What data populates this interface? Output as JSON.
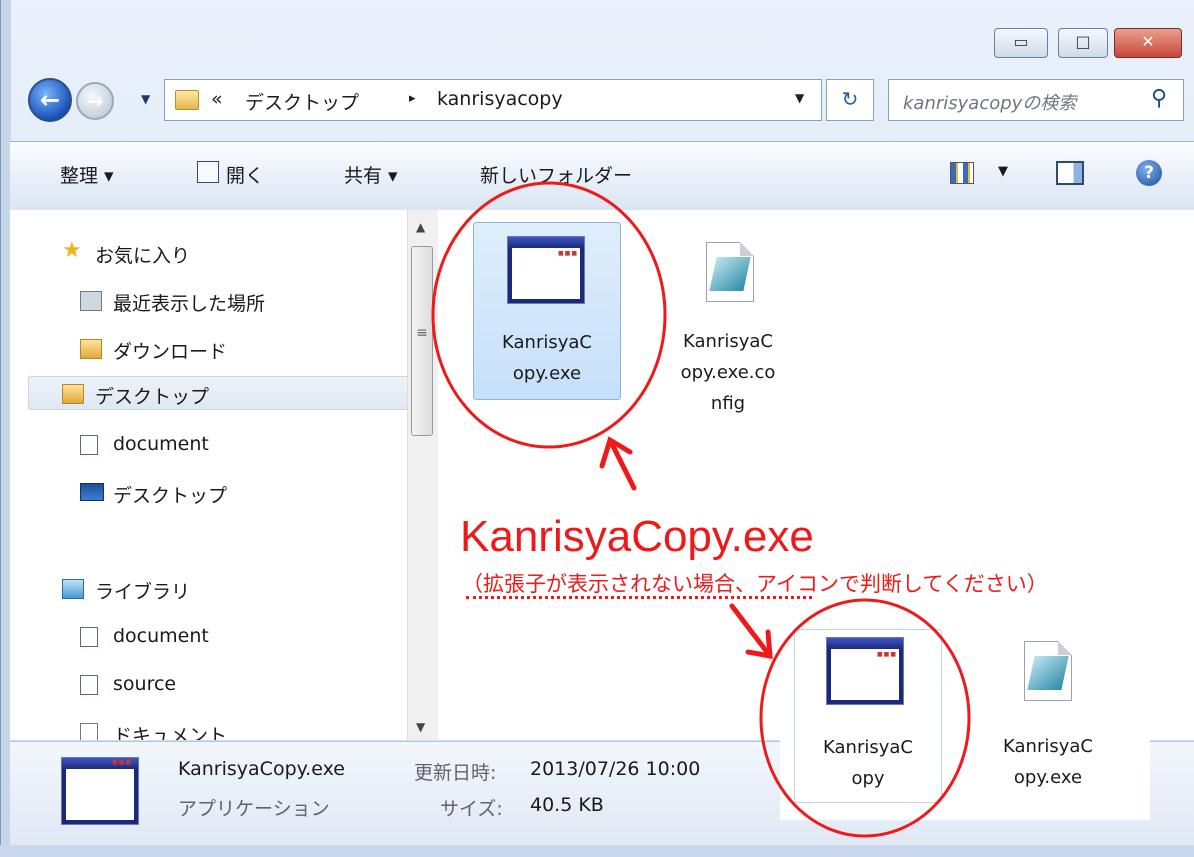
{
  "window": {
    "caption_buttons": [
      "▭",
      "□",
      "✕"
    ]
  },
  "navbar": {
    "back_icon": "arrow-left-icon",
    "forward_icon": "arrow-right-icon",
    "breadcrumb": {
      "overflow": "«",
      "parent": "デスクトップ",
      "separator": "▸",
      "current": "kanrisyacopy"
    },
    "search_placeholder": "kanrisyacopyの検索"
  },
  "toolbar": {
    "organize": "整理 ▾",
    "open": "開く",
    "share": "共有 ▾",
    "new_folder": "新しいフォルダー"
  },
  "sidebar": {
    "favorites": {
      "label": "お気に入り",
      "items": [
        "最近表示した場所",
        "ダウンロード",
        "デスクトップ",
        "document",
        "デスクトップ"
      ]
    },
    "libraries": {
      "label": "ライブラリ",
      "items": [
        "document",
        "source",
        "ドキュメント"
      ]
    },
    "selected_index": 2
  },
  "files": [
    {
      "name_lines": [
        "KanrisyaC",
        "opy.exe"
      ],
      "type": "application",
      "selected": true
    },
    {
      "name_lines": [
        "KanrisyaC",
        "opy.exe.co",
        "nfig"
      ],
      "type": "config",
      "selected": false
    }
  ],
  "details": {
    "filename": "KanrisyaCopy.exe",
    "modified_label": "更新日時:",
    "modified_value": "2013/07/26 10:00",
    "type": "アプリケーション",
    "size_label": "サイズ:",
    "size_value": "40.5 KB"
  },
  "annotation": {
    "title": "KanrisyaCopy.exe",
    "note": "（拡張子が表示されない場合、アイコンで判断してください）",
    "color": "#f01919",
    "inset_files": [
      {
        "name_lines": [
          "KanrisyaC",
          "opy"
        ],
        "type": "application"
      },
      {
        "name_lines": [
          "KanrisyaC",
          "opy.exe"
        ],
        "type": "config"
      }
    ]
  }
}
